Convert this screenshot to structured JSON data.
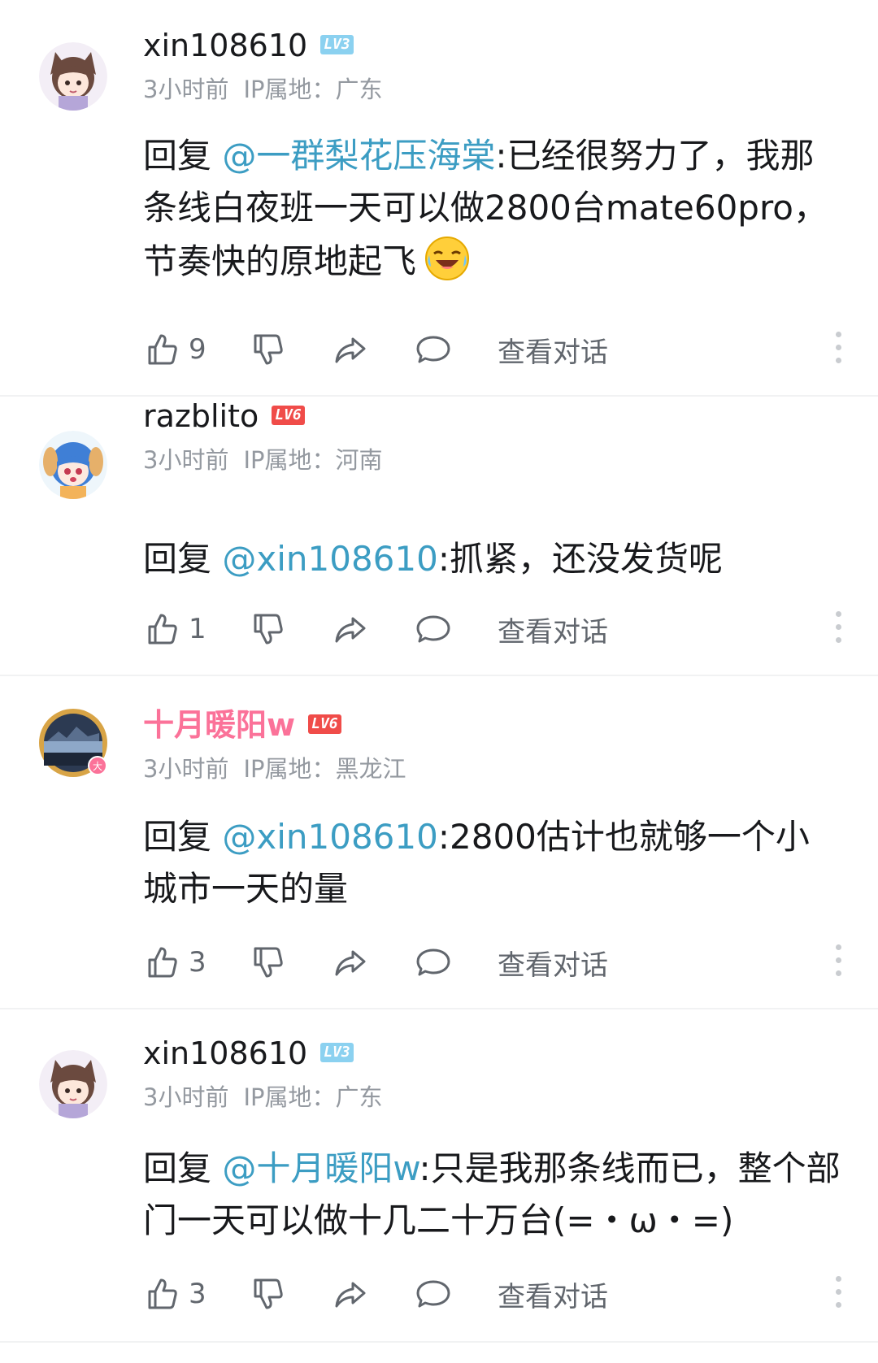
{
  "colors": {
    "mention": "#3c9dc3",
    "pink_name": "#fb7299",
    "meta": "#9499a0",
    "lv3": "#8bd1f0",
    "lv6": "#f04c49"
  },
  "actions": {
    "view_conversation_label": "查看对话",
    "icons": [
      "thumbs-up-icon",
      "thumbs-down-icon",
      "share-icon",
      "comment-icon",
      "more-icon"
    ]
  },
  "comments": [
    {
      "username": "xin108610",
      "level": "LV3",
      "time": "3小时前",
      "ip": "IP属地：广东",
      "reply_prefix": "回复",
      "mention": "@一群梨花压海棠",
      "text": ":已经很努力了，我那条线白夜班一天可以做2800台mate60pro，节奏快的原地起飞",
      "emoji": "crying-laughing-emoji",
      "likes": "9"
    },
    {
      "username": "razblito",
      "level": "LV6",
      "time": "3小时前",
      "ip": "IP属地：河南",
      "reply_prefix": "回复",
      "mention": "@xin108610",
      "text": ":抓紧，还没发货呢",
      "likes": "1"
    },
    {
      "username": "十月暖阳w",
      "level": "LV6",
      "time": "3小时前",
      "ip": "IP属地：黑龙江",
      "reply_prefix": "回复",
      "mention": "@xin108610",
      "text": ":2800估计也就够一个小城市一天的量",
      "likes": "3"
    },
    {
      "username": "xin108610",
      "level": "LV3",
      "time": "3小时前",
      "ip": "IP属地：广东",
      "reply_prefix": "回复",
      "mention": "@十月暖阳w",
      "text": ":只是我那条线而已，整个部门一天可以做十几二十万台(=・ω・=)",
      "likes": "3"
    }
  ]
}
